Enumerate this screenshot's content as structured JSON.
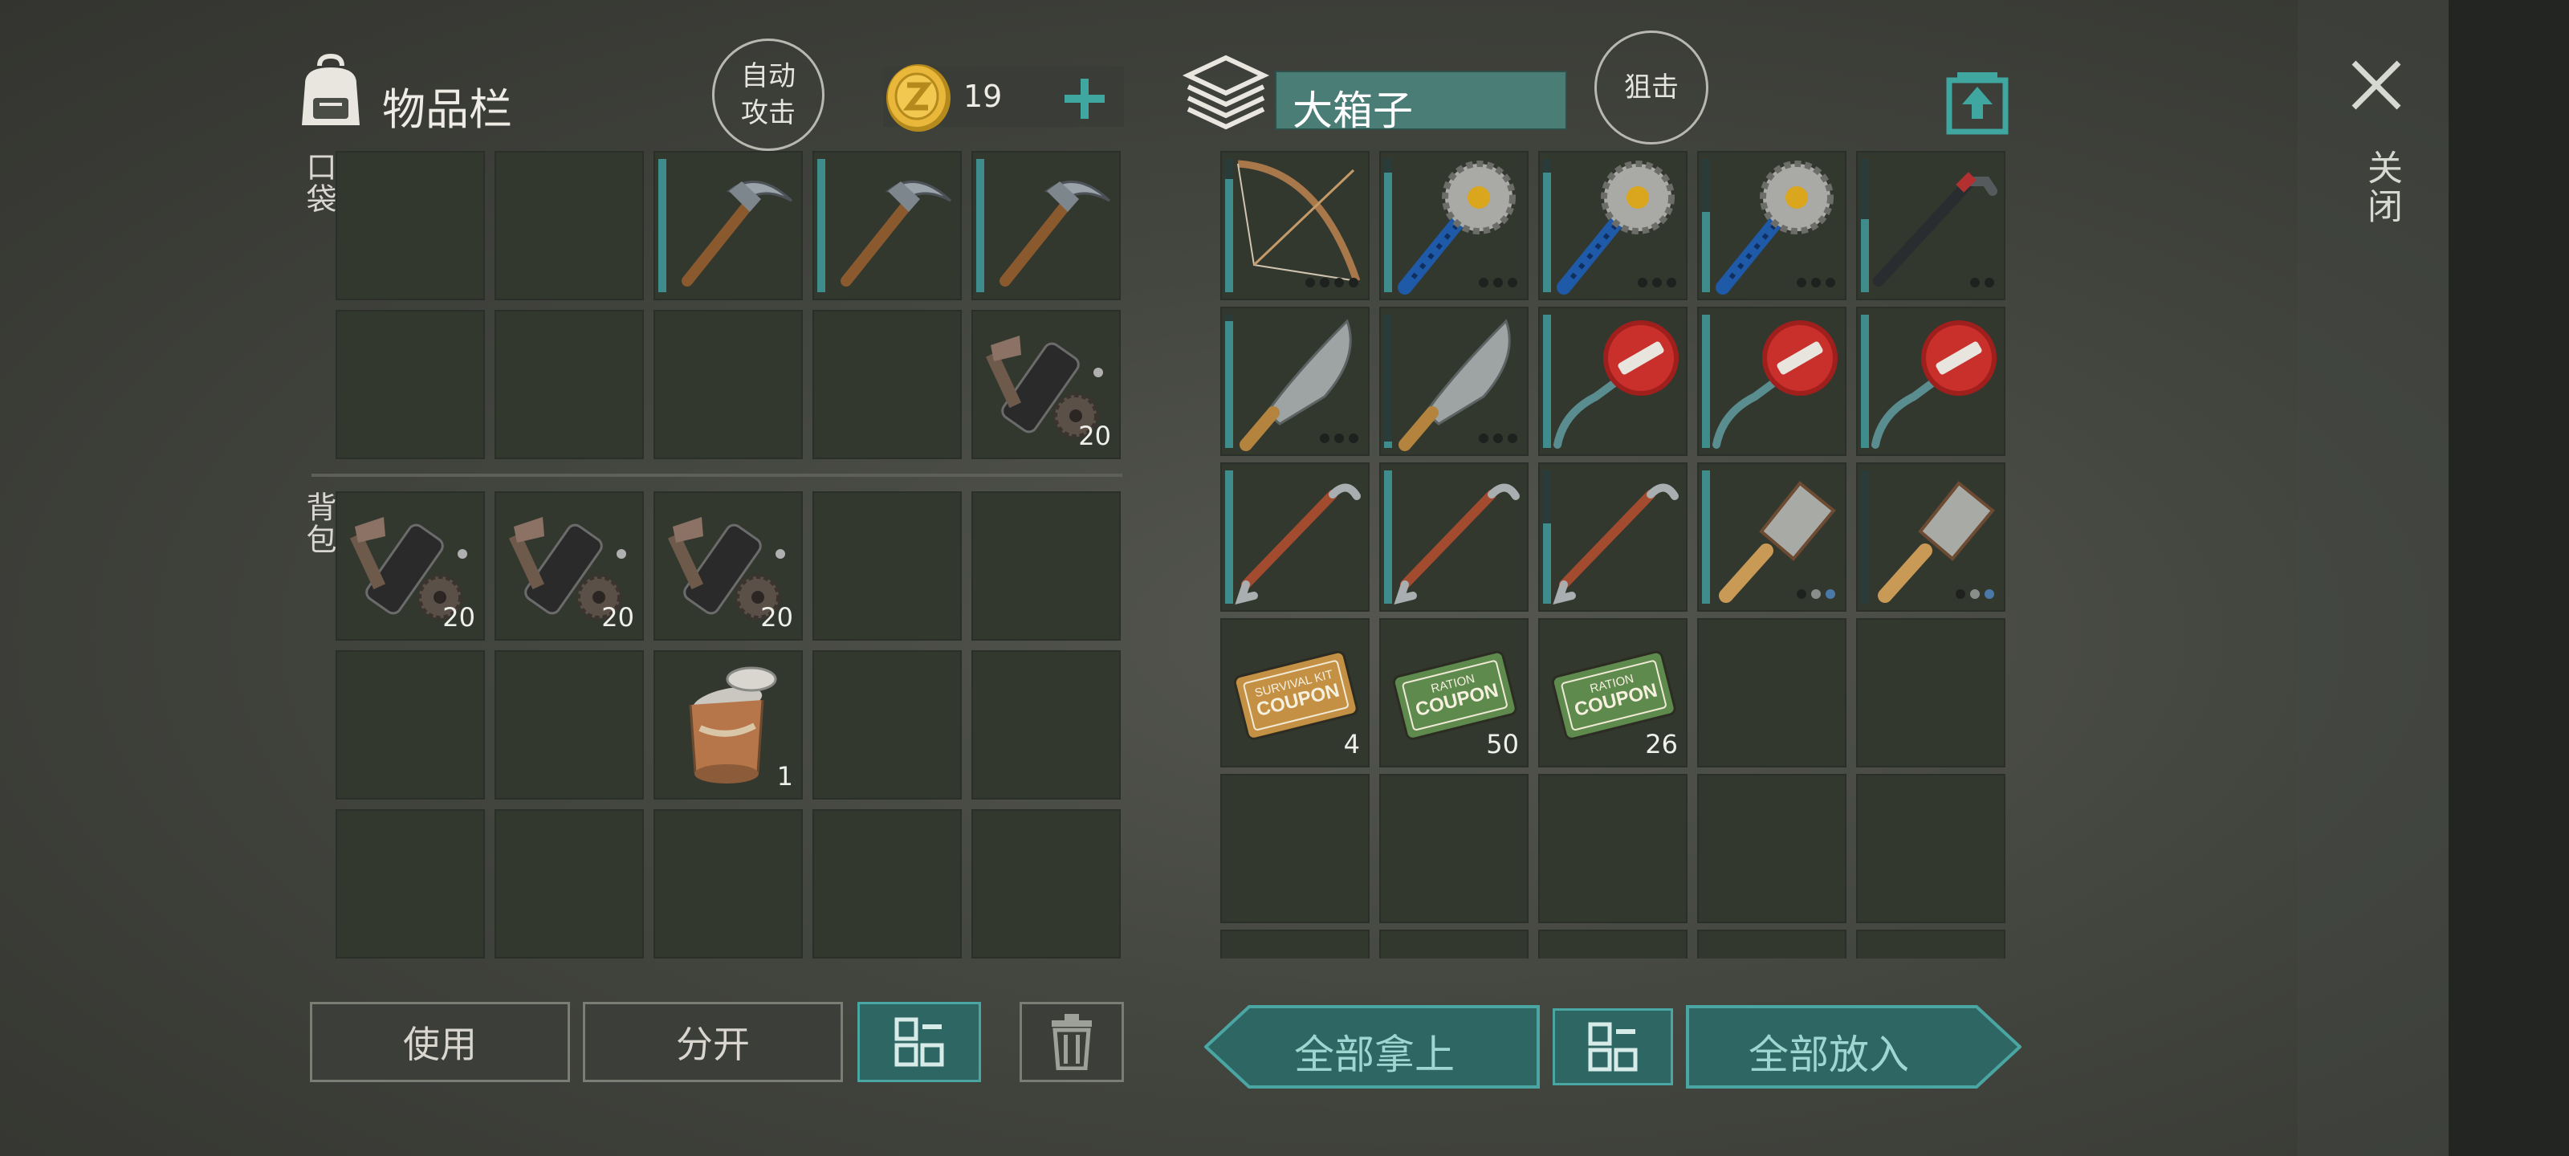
{
  "inventory": {
    "title": "物品栏",
    "auto_attack": "自动\n攻击",
    "coins": "19",
    "pocket_label": "口袋",
    "backpack_label": "背包",
    "pocket_slots": [
      {
        "item": "empty"
      },
      {
        "item": "empty"
      },
      {
        "item": "pickaxe",
        "durability": 1.0
      },
      {
        "item": "pickaxe",
        "durability": 1.0
      },
      {
        "item": "pickaxe",
        "durability": 1.0
      },
      {
        "item": "empty"
      },
      {
        "item": "empty"
      },
      {
        "item": "empty"
      },
      {
        "item": "empty"
      },
      {
        "item": "parts-bundle",
        "qty": "20"
      }
    ],
    "backpack_slots": [
      {
        "item": "parts-bundle",
        "qty": "20"
      },
      {
        "item": "parts-bundle",
        "qty": "20"
      },
      {
        "item": "parts-bundle",
        "qty": "20"
      },
      {
        "item": "empty"
      },
      {
        "item": "empty"
      },
      {
        "item": "empty"
      },
      {
        "item": "empty"
      },
      {
        "item": "tin-can",
        "qty": "1"
      },
      {
        "item": "empty"
      },
      {
        "item": "empty"
      },
      {
        "item": "empty"
      },
      {
        "item": "empty"
      },
      {
        "item": "empty"
      },
      {
        "item": "empty"
      },
      {
        "item": "empty"
      }
    ],
    "use_button": "使用",
    "split_button": "分开"
  },
  "chest": {
    "title": "大箱子",
    "snipe_button": "狙击",
    "slots": [
      {
        "item": "bow",
        "durability": 0.85,
        "dots": [
          "dark",
          "dark",
          "dark",
          "dark"
        ]
      },
      {
        "item": "saw-mace",
        "durability": 0.9,
        "dots": [
          "dark",
          "dark",
          "dark"
        ]
      },
      {
        "item": "saw-mace",
        "durability": 0.9,
        "dots": [
          "dark",
          "dark",
          "dark"
        ]
      },
      {
        "item": "saw-mace",
        "durability": 0.6,
        "dots": [
          "dark",
          "dark",
          "dark"
        ]
      },
      {
        "item": "crowbar-black",
        "durability": 0.55,
        "dots": [
          "dark",
          "dark"
        ]
      },
      {
        "item": "machete",
        "durability": 0.95,
        "dots": [
          "dark",
          "dark",
          "dark"
        ]
      },
      {
        "item": "machete",
        "durability": 0.05,
        "dots": [
          "dark",
          "dark",
          "dark"
        ]
      },
      {
        "item": "stop-sign",
        "durability": 1.0
      },
      {
        "item": "stop-sign",
        "durability": 1.0
      },
      {
        "item": "stop-sign",
        "durability": 1.0
      },
      {
        "item": "crowbar-red",
        "durability": 1.0
      },
      {
        "item": "crowbar-red",
        "durability": 1.0
      },
      {
        "item": "crowbar-red",
        "durability": 0.6
      },
      {
        "item": "cleaver",
        "durability": 1.0,
        "dots": [
          "dark",
          "gray",
          "blue"
        ]
      },
      {
        "item": "cleaver",
        "durability": 0.0,
        "dots": [
          "dark",
          "gray",
          "blue"
        ]
      },
      {
        "item": "survival-coupon",
        "qty": "4",
        "label_top": "SURVIVAL KIT",
        "label_main": "COUPON"
      },
      {
        "item": "ration-coupon",
        "qty": "50",
        "label_top": "RATION",
        "label_main": "COUPON"
      },
      {
        "item": "ration-coupon",
        "qty": "26",
        "label_top": "RATION",
        "label_main": "COUPON"
      },
      {
        "item": "empty"
      },
      {
        "item": "empty"
      },
      {
        "item": "empty"
      },
      {
        "item": "empty"
      },
      {
        "item": "empty"
      },
      {
        "item": "empty"
      },
      {
        "item": "empty"
      },
      {
        "item": "empty"
      },
      {
        "item": "empty"
      },
      {
        "item": "empty"
      },
      {
        "item": "empty"
      },
      {
        "item": "empty"
      }
    ],
    "take_all_button": "全部拿上",
    "put_all_button": "全部放入"
  },
  "close_label": "关闭",
  "colors": {
    "accent_teal": "#4aa6a3",
    "durability": "#3f8c8c",
    "slot": "#33382f"
  }
}
